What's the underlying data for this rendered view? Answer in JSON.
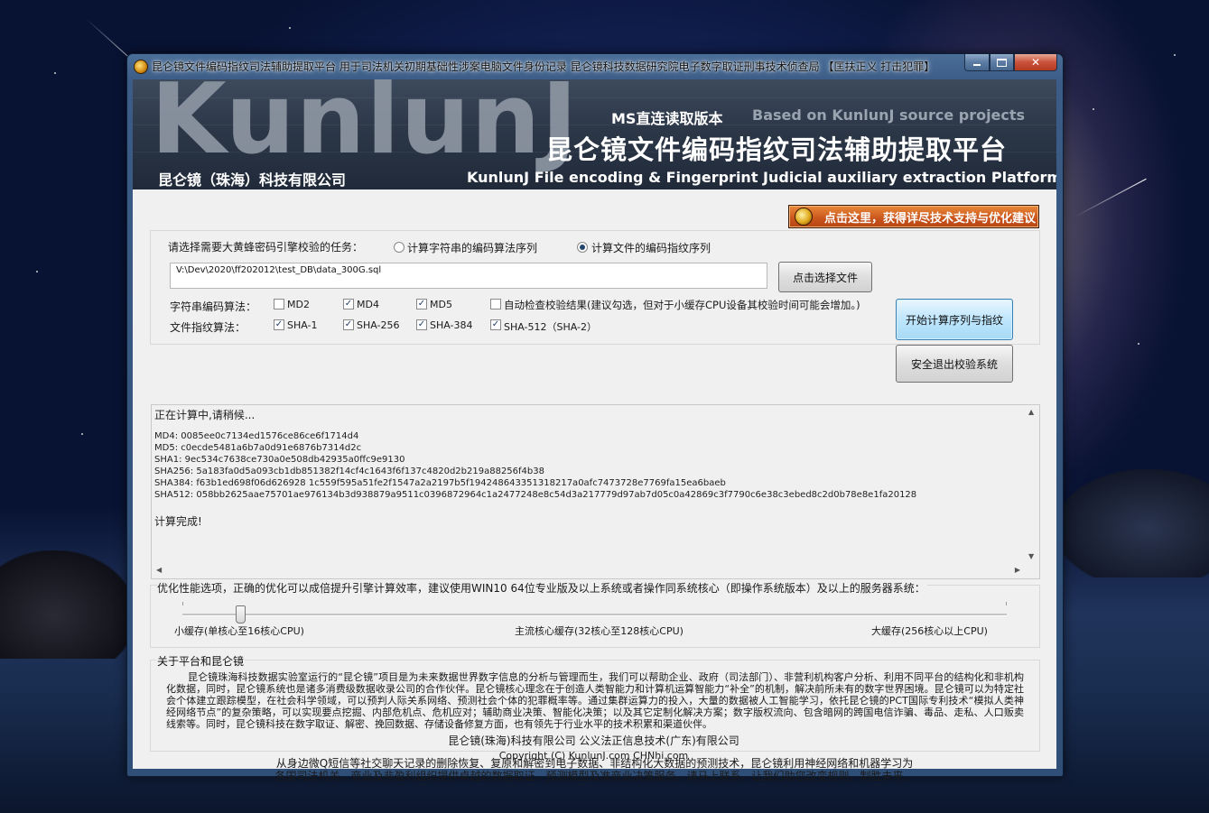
{
  "window": {
    "title": "昆仑镜文件编码指纹司法辅助提取平台 用于司法机关初期基础性涉案电脑文件身份记录 昆仑镜科技数据研究院电子数字取证刑事技术侦查局    【匡扶正义 打击犯罪】"
  },
  "banner": {
    "big_text": "KunlunJ",
    "company": "昆仑镜（珠海）科技有限公司",
    "edition": "MS直连读取版本",
    "based_on": "Based on KunlunJ source projects",
    "title_cn": "昆仑镜文件编码指纹司法辅助提取平台",
    "title_en": "KunlunJ File encoding & Fingerprint Judicial auxiliary extraction Platform"
  },
  "promo": {
    "label": "点击这里，获得详尽技术支持与优化建议"
  },
  "task": {
    "prompt": "请选择需要大黄蜂密码引擎校验的任务：",
    "options": [
      {
        "label": "计算字符串的编码算法序列",
        "selected": false
      },
      {
        "label": "计算文件的编码指纹序列",
        "selected": true
      }
    ],
    "file_path": "V:\\Dev\\2020\\ff202012\\test_DB\\data_300G.sql",
    "choose_file_label": "点击选择文件",
    "start_label": "开始计算序列与指纹",
    "exit_label": "安全退出校验系统"
  },
  "string_algos": {
    "label": "字符串编码算法：",
    "items": [
      {
        "name": "MD2",
        "checked": false
      },
      {
        "name": "MD4",
        "checked": true
      },
      {
        "name": "MD5",
        "checked": true
      }
    ],
    "auto_check": {
      "label": "自动检查校验结果(建议勾选，但对于小缓存CPU设备其校验时间可能会增加。)",
      "checked": false
    }
  },
  "file_algos": {
    "label": "文件指纹算法：",
    "items": [
      {
        "name": "SHA-1",
        "checked": true
      },
      {
        "name": "SHA-256",
        "checked": true
      },
      {
        "name": "SHA-384",
        "checked": true
      },
      {
        "name": "SHA-512（SHA-2）",
        "checked": true
      }
    ]
  },
  "output": {
    "status": "正在计算中,请稍候...",
    "lines": [
      "MD4: 0085ee0c7134ed1576ce86ce6f1714d4",
      "MD5: c0ecde5481a6b7a0d91e6876b7314d2c",
      "SHA1: 9ec534c7638ce730a0e508db42935a0ffc9e9130",
      "SHA256: 5a183fa0d5a093cb1db851382f14cf4c1643f6f137c4820d2b219a88256f4b38",
      "SHA384: f63b1ed698f06d626928 1c559f595a51fe2f1547a2a2197b5f194248643351318217a0afc7473728e7769fa15ea6baeb",
      "SHA512: 058bb2625aae75701ae976134b3d938879a9511c0396872964c1a2477248e8c54d3a217779d97ab7d05c0a42869c3f7790c6e38c3ebed8c2d0b78e8e1fa20128"
    ],
    "done": "计算完成!"
  },
  "performance": {
    "label": "优化性能选项，正确的优化可以成倍提升引擎计算效率，建议使用WIN10 64位专业版及以上系统或者操作同系统核心（即操作系统版本）及以上的服务器系统：",
    "small": "小缓存(单核心至16核心CPU)",
    "medium": "主流核心缓存(32核心至128核心CPU)",
    "large": "大缓存(256核心以上CPU)",
    "level": 0.07
  },
  "about": {
    "title": "关于平台和昆仑镜",
    "text": "昆仑镜珠海科技数据实验室运行的“昆仑镜”项目是为未来数据世界数字信息的分析与管理而生，我们可以帮助企业、政府（司法部门）、非营利机构客户分析、利用不同平台的结构化和非机构化数据，同时，昆仑镜系统也是诸多消费级数据收录公司的合作伙伴。昆仑镜核心理念在于创造人类智能力和计算机运算智能力“补全”的机制，解决前所未有的数字世界困境。昆仑镜可以为特定社会个体建立跟踪模型，在社会科学领域，可以预判人际关系网络、预测社会个体的犯罪概率等。通过集群运算力的投入，大量的数据被人工智能学习，依托昆仑镜的PCT国际专利技术“模拟人类神经网络节点”的复杂策略，可以实现要点挖掘、内部危机点、危机应对；辅助商业决策、智能化决策；以及其它定制化解决方案；数字版权流向、包含暗网的跨国电信诈骗、毒品、走私、人口贩卖线索等。同时，昆仑镜科技在数字取证、解密、挽回数据、存储设备修复方面，也有领先于行业水平的技术积累和渠道伙伴。"
  },
  "footer": {
    "line1": "从身边微Q短信等社交聊天记录的删除恢复、复原和解密到电子数据、非结构化大数据的预测技术，昆仑镜利用神经网络和机器学习为",
    "line2": "各国司法机关、商业及非盈利组织提供卓越的数据取证、预测模型及准商业决策服务。请马上联系，让我们助您改变规则，制胜未来。",
    "company": "昆仑镜(珠海)科技有限公司 公义法正信息技术(广东)有限公司",
    "copyright": "Copyright (C) KunlunJ.com  CHNhi.com"
  },
  "colors": {
    "window_frame": "#3b5c86",
    "banner_bg": "#2c3748",
    "promo_orange": "#c9541c",
    "primary_button": "#bee6fd"
  }
}
